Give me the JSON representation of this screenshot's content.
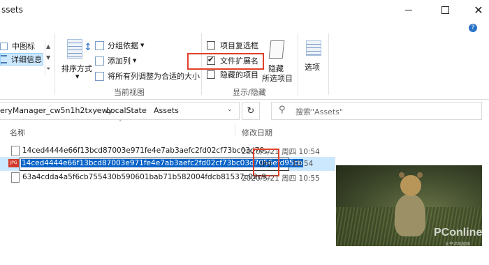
{
  "window": {
    "title": "ssets",
    "minimize_icon": "minimize",
    "maximize_icon": "maximize",
    "close_icon": "close",
    "help_icon": "help"
  },
  "ribbon": {
    "layout": {
      "medium_icons": "中图标",
      "details": "详细信息"
    },
    "sort_label": "排序方式",
    "current_view": {
      "group_by": "分组依据",
      "add_columns": "添加列",
      "size_all_columns": "将所有列调整为合适的大小",
      "group_label": "当前视图"
    },
    "show_hide": {
      "item_checkboxes": {
        "label": "项目复选框",
        "checked": false
      },
      "file_name_extensions": {
        "label": "文件扩展名",
        "checked": true
      },
      "hidden_items": {
        "label": "隐藏的项目",
        "checked": false
      },
      "hide_selected_line1": "隐藏",
      "hide_selected_line2": "所选项目",
      "group_label": "显示/隐藏"
    },
    "options_label": "选项"
  },
  "address": {
    "path": [
      "eryManager_cw5n1h2txyewy",
      "LocalState",
      "Assets"
    ],
    "separator": "›",
    "search_placeholder": "搜索\"Assets\""
  },
  "columns": {
    "name": "名称",
    "date_modified": "修改日期"
  },
  "files": [
    {
      "name": "14ced4444e66f13bcd87003e971fe4e7ab3aefc2fd02cf73bc03d70...",
      "date": "2020/5/21 周四 10:54",
      "selected": false
    },
    {
      "name_selected": "14ced4444e66f13bcd87003e971fe4e7ab3aefc2fd02cf73bc03d7056efd95cb",
      "name_extension": ".jpg",
      "type_badge": "JPG",
      "date": "2020/5/21 周四 10:54",
      "selected": true
    },
    {
      "name": "63a4cdda4a5f6cb755430b590601bab71b582004fdcb81537c02c9...",
      "date": "2020/5/21 周四 10:55",
      "selected": false
    }
  ],
  "preview": {
    "watermark": "PConline",
    "watermark_sub": "太平洋电脑网",
    "subject": "cheetah-cub-photo"
  },
  "colors": {
    "selection": "#cce8ff",
    "rename_highlight": "#0a64c8",
    "annotation": "#e0402a",
    "icon_blue": "#2a73c6"
  }
}
